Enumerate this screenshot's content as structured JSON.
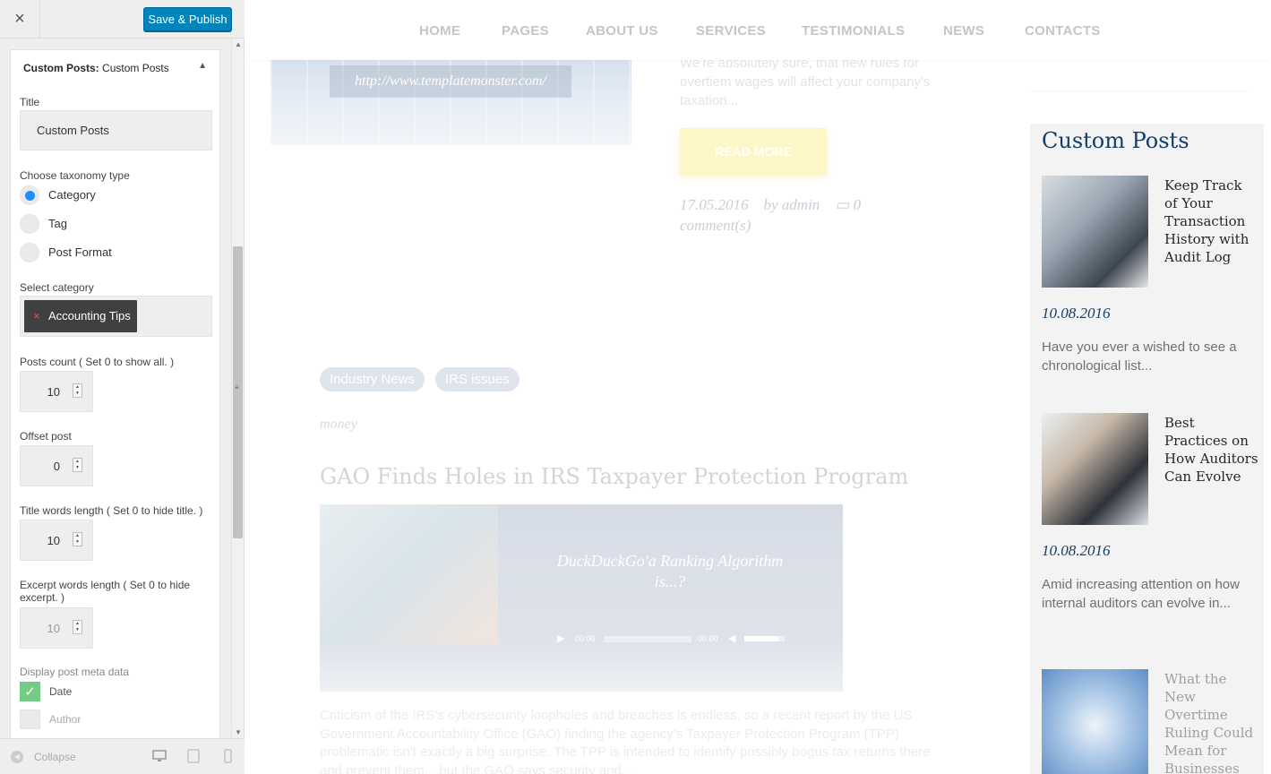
{
  "customizer": {
    "close_label": "×",
    "publish_label": "Save & Publish",
    "widget_title_bold": "Custom Posts:",
    "widget_title_rest": " Custom Posts",
    "fields": {
      "title_label": "Title",
      "title_value": "Custom Posts",
      "taxonomy_label": "Choose taxonomy type",
      "taxonomy_options": [
        "Category",
        "Tag",
        "Post Format"
      ],
      "taxonomy_selected": "Category",
      "category_label": "Select category",
      "category_chip": "Accounting Tips",
      "posts_count_label": "Posts count ( Set 0 to show all. )",
      "posts_count_value": "10",
      "offset_label": "Offset post",
      "offset_value": "0",
      "title_words_label": "Title words length ( Set 0 to hide title. )",
      "title_words_value": "10",
      "excerpt_words_label": "Excerpt words length ( Set 0 to hide excerpt. )",
      "excerpt_words_value": "10",
      "meta_label": "Display post meta data",
      "meta_options": [
        "Date",
        "Author"
      ]
    },
    "footer": {
      "collapse_label": "Collapse"
    }
  },
  "preview": {
    "nav": [
      "HOME",
      "PAGES",
      "ABOUT US",
      "SERVICES",
      "TESTIMONIALS",
      "NEWS",
      "CONTACTS"
    ],
    "hero_url": "http://www.templatemonster.com/",
    "excerpt_top": "We're absolutely sure, that new rules for overtiem wages will affect your company's taxation...",
    "read_more": "READ MORE",
    "post_date": "17.05.2016",
    "post_author": "by admin",
    "post_comments": "0 comment(s)",
    "tags": [
      "Industry News",
      "IRS issues"
    ],
    "category": "money",
    "post_title": "GAO Finds Holes in IRS Taxpayer Protection Program",
    "video_title": "DuckDuckGo'a Ranking Algorithm is...?",
    "video_time_current": "00:00",
    "video_time_total": "00:00",
    "body_text": "Criticism of the IRS's cybersecurity loopholes and breaches is endless, so a recent report by the US Government Accountability Office (GAO) finding the agency's Taxpayer Protection Program (TPP) problematic isn't exactly a big surprise. The TPP is intended to identify possibly bogus tax returns there and prevent them... but the GAO says security and..."
  },
  "sidebar": {
    "title": "Custom Posts",
    "posts": [
      {
        "title": "Keep Track of Your Transaction History with Audit Log",
        "date": "10.08.2016",
        "excerpt": "Have you ever a wished to see a chronological list..."
      },
      {
        "title": "Best Practices on How Auditors Can Evolve",
        "date": "10.08.2016",
        "excerpt": "Amid increasing attention on how internal auditors can evolve in..."
      },
      {
        "title": "What the New Overtime Ruling Could Mean for Businesses",
        "date": "",
        "excerpt": ""
      }
    ]
  },
  "colors": {
    "publish_button": "#0085ba",
    "radio_selected": "#1e8cfa",
    "sidebar_title": "#143d6b",
    "check_on": "#5cc46f"
  }
}
